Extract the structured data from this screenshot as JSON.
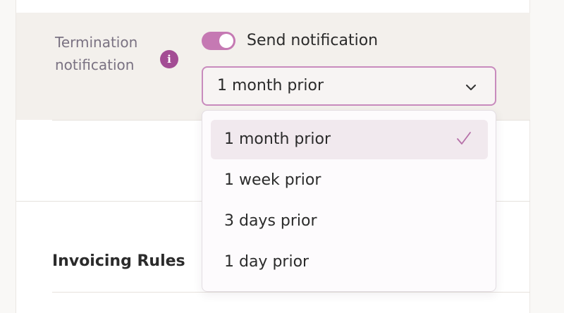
{
  "termination": {
    "label_line1": "Termination",
    "label_line2": "notification",
    "info_glyph": "i",
    "toggle_on": true,
    "toggle_label": "Send notification",
    "selected_value": "1 month prior"
  },
  "dropdown": {
    "options": [
      {
        "label": "1 month prior",
        "selected": true
      },
      {
        "label": "1 week prior",
        "selected": false
      },
      {
        "label": "3 days prior",
        "selected": false
      },
      {
        "label": "1 day prior",
        "selected": false
      }
    ]
  },
  "sections": {
    "invoicing_title": "Invoicing Rules"
  },
  "icons": {
    "info": "info-icon",
    "chevron": "chevron-down-icon",
    "check": "checkmark-icon"
  },
  "colors": {
    "accent": "#a34d94",
    "toggle_on": "#c579b3",
    "select_border": "#c88bbd",
    "selected_option_bg": "#f1e9ee"
  }
}
